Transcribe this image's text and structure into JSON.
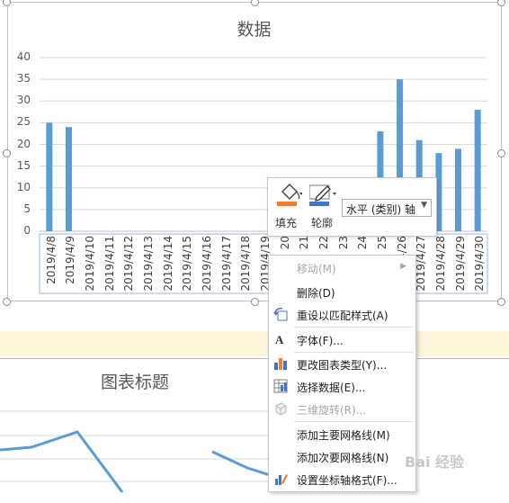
{
  "chart_data": [
    {
      "type": "bar",
      "title": "数据",
      "ylim": [
        0,
        40
      ],
      "yticks": [
        "0",
        "5",
        "10",
        "15",
        "20",
        "25",
        "30",
        "35",
        "40"
      ],
      "grid": true,
      "categories": [
        "2019/4/8",
        "2019/4/9",
        "2019/4/10",
        "2019/4/11",
        "2019/4/12",
        "2019/4/13",
        "2019/4/14",
        "2019/4/15",
        "2019/4/16",
        "2019/4/17",
        "2019/4/18",
        "2019/4/19",
        "20",
        "21",
        "22",
        "23",
        "24",
        "25",
        "2019/4/26",
        "2019/4/27",
        "2019/4/28",
        "2019/4/29",
        "2019/4/30"
      ],
      "values": [
        25,
        24,
        0,
        0,
        0,
        0,
        0,
        0,
        0,
        0,
        0,
        0,
        0,
        0,
        0,
        0,
        0,
        23,
        35,
        21,
        18,
        19,
        28
      ],
      "color": "#5b9bd5"
    },
    {
      "type": "line",
      "title": "图表标题",
      "color": "#5b9bd5"
    }
  ],
  "mini_toolbar": {
    "fill_label": "填充",
    "outline_label": "轮廓",
    "axis_select_value": "水平 (类别) 轴",
    "fill_color": "#ed7d31",
    "outline_color": "#4472c4",
    "fill_icon": "paint-bucket-icon",
    "outline_icon": "pen-icon"
  },
  "context_menu": {
    "items": [
      {
        "label": "移动(M)",
        "disabled": true,
        "submenu": true
      },
      {
        "label": "删除(D)",
        "disabled": false
      },
      {
        "label": "重设以匹配样式(A)",
        "disabled": false,
        "icon": "reset-style-icon"
      },
      {
        "label": "字体(F)...",
        "disabled": false,
        "icon": "font-icon"
      },
      {
        "label": "更改图表类型(Y)...",
        "disabled": false,
        "icon": "chart-type-icon"
      },
      {
        "label": "选择数据(E)...",
        "disabled": false,
        "icon": "select-data-icon"
      },
      {
        "label": "三维旋转(R)...",
        "disabled": true,
        "icon": "rotate-3d-icon"
      },
      {
        "label": "添加主要网格线(M)",
        "disabled": false
      },
      {
        "label": "添加次要网格线(N)",
        "disabled": false
      },
      {
        "label": "设置坐标轴格式(F)...",
        "disabled": false,
        "icon": "format-axis-icon"
      }
    ]
  },
  "watermark": "Bai 经验"
}
